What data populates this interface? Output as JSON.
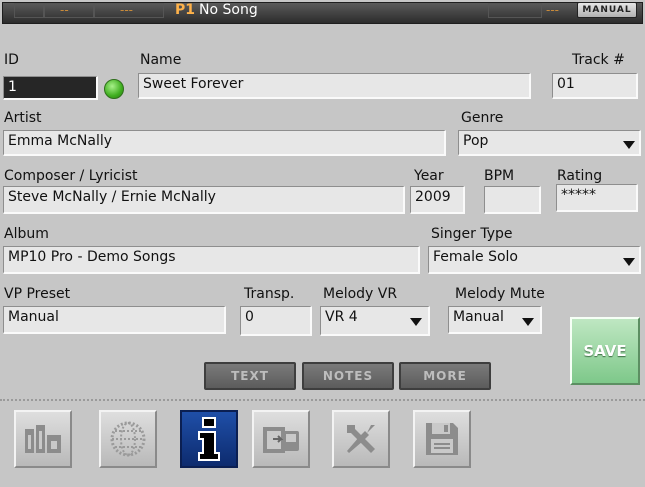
{
  "topbar": {
    "dash_left_1": "--",
    "dash_left_2": "---",
    "slot": "P1",
    "song": "No Song",
    "dash_right": "---",
    "mode_button": "MANUAL"
  },
  "id": {
    "label": "ID",
    "value": "1"
  },
  "name": {
    "label": "Name",
    "value": "Sweet Forever"
  },
  "track": {
    "label": "Track #",
    "value": "01"
  },
  "artist": {
    "label": "Artist",
    "value": "Emma McNally"
  },
  "genre": {
    "label": "Genre",
    "value": "Pop"
  },
  "composer": {
    "label": "Composer / Lyricist",
    "value": "Steve McNally / Ernie McNally"
  },
  "year": {
    "label": "Year",
    "value": "2009"
  },
  "bpm": {
    "label": "BPM",
    "value": ""
  },
  "rating": {
    "label": "Rating",
    "value": "*****"
  },
  "album": {
    "label": "Album",
    "value": "MP10 Pro - Demo Songs"
  },
  "singer_type": {
    "label": "Singer Type",
    "value": "Female Solo"
  },
  "vp_preset": {
    "label": "VP Preset",
    "value": "Manual"
  },
  "transp": {
    "label": "Transp.",
    "value": "0"
  },
  "melody_vr": {
    "label": "Melody VR",
    "value": "VR 4"
  },
  "melody_mute": {
    "label": "Melody Mute",
    "value": "Manual"
  },
  "tabs": {
    "text": "TEXT",
    "notes": "NOTES",
    "more": "MORE"
  },
  "save_label": "SAVE",
  "nav_icons": [
    "library-icon",
    "globe-icon",
    "info-icon",
    "media-transfer-icon",
    "tools-icon",
    "floppy-disk-icon"
  ],
  "colors": {
    "active_nav": "#1a4aa0",
    "save": "#8fd39a",
    "led": "#3fae1f",
    "topbar_accent": "#ffb24a"
  }
}
